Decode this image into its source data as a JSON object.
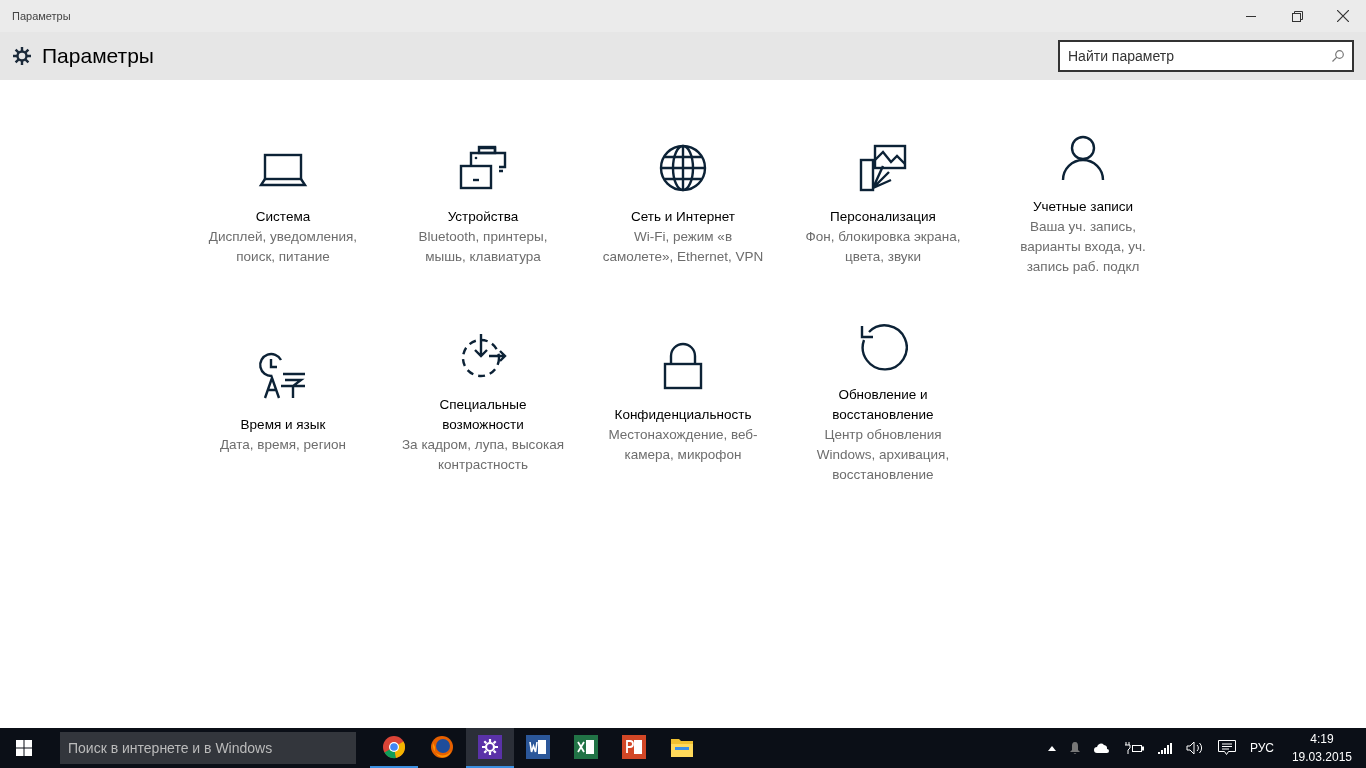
{
  "window": {
    "title": "Параметры"
  },
  "header": {
    "title": "Параметры",
    "search": {
      "placeholder": "Найти параметр"
    }
  },
  "tiles": [
    {
      "kind": "system",
      "title": "Система",
      "description": "Дисплей, уведомления, поиск, питание"
    },
    {
      "kind": "devices",
      "title": "Устройства",
      "description": "Bluetooth, принтеры, мышь, клавиатура"
    },
    {
      "kind": "network",
      "title": "Сеть и Интернет",
      "description": "Wi-Fi, режим «в самолете», Ethernet, VPN"
    },
    {
      "kind": "personalization",
      "title": "Персонализация",
      "description": "Фон, блокировка экрана, цвета, звуки"
    },
    {
      "kind": "accounts",
      "title": "Учетные записи",
      "description": "Ваша уч. запись, варианты входа, уч. запись раб. подкл"
    },
    {
      "kind": "time",
      "title": "Время и язык",
      "description": "Дата, время, регион"
    },
    {
      "kind": "accessibility",
      "title": "Специальные возможности",
      "description": "За кадром, лупа, высокая контрастность"
    },
    {
      "kind": "privacy",
      "title": "Конфиденциальность",
      "description": "Местонахождение, веб-камера, микрофон"
    },
    {
      "kind": "update",
      "title": "Обновление и восстановление",
      "description": "Центр обновления Windows, архивация, восстановление"
    }
  ],
  "taskbar": {
    "search": {
      "placeholder": "Поиск в интернете и в Windows"
    },
    "apps": [
      {
        "kind": "chrome",
        "running": true,
        "selected": false
      },
      {
        "kind": "firefox",
        "running": false,
        "selected": false
      },
      {
        "kind": "settings",
        "running": true,
        "selected": true
      },
      {
        "kind": "word",
        "running": false,
        "selected": false
      },
      {
        "kind": "excel",
        "running": false,
        "selected": false
      },
      {
        "kind": "powerpoint",
        "running": false,
        "selected": false
      },
      {
        "kind": "explorer",
        "running": false,
        "selected": false
      }
    ],
    "language": "РУС",
    "time": "4:19",
    "date": "19.03.2015"
  }
}
